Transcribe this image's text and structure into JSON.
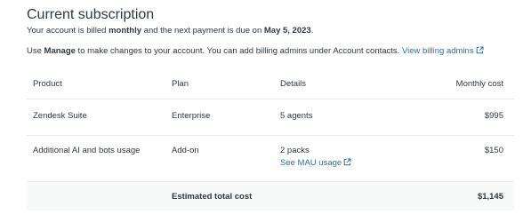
{
  "header": {
    "title": "Current subscription",
    "billing_prefix": "Your account is billed ",
    "billing_period": "monthly",
    "billing_middle": " and the next payment is due on ",
    "due_date": "May 5, 2023",
    "billing_suffix": "."
  },
  "manage_info": {
    "prefix": "Use ",
    "manage_word": "Manage",
    "text": " to make changes to your account. You can add billing admins under Account contacts. ",
    "link_label": "View billing admins"
  },
  "table": {
    "columns": {
      "product": "Product",
      "plan": "Plan",
      "details": "Details",
      "cost": "Monthly cost"
    },
    "rows": [
      {
        "product": "Zendesk Suite",
        "plan": "Enterprise",
        "details": "5 agents",
        "cost": "$995"
      },
      {
        "product": "Additional AI and bots usage",
        "plan": "Add-on",
        "details": "2 packs",
        "details_link": "See MAU usage",
        "cost": "$150"
      }
    ],
    "total": {
      "label": "Estimated total cost",
      "value": "$1,145"
    }
  },
  "colors": {
    "text": "#2f3941",
    "link": "#1f73b7",
    "border": "#e9ebed",
    "total_background": "#f8f9f9"
  },
  "icons": {
    "external_link": "external-link-icon"
  }
}
